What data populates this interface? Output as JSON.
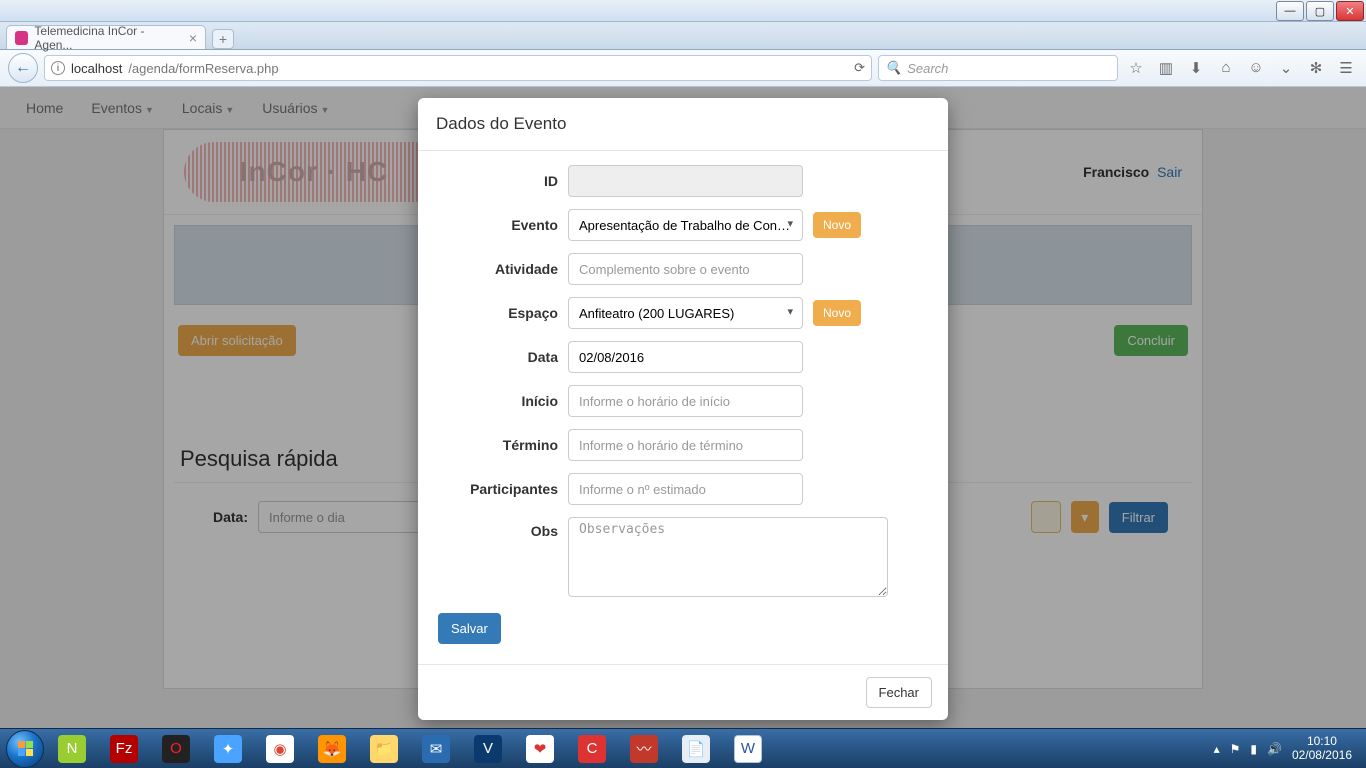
{
  "window": {
    "tab_title": "Telemedicina InCor - Agen...",
    "url_host": "localhost",
    "url_path": "/agenda/formReserva.php",
    "search_placeholder": "Search"
  },
  "nav": {
    "home": "Home",
    "eventos": "Eventos",
    "locais": "Locais",
    "usuarios": "Usuários"
  },
  "user": {
    "name": "Francisco",
    "logout": "Sair"
  },
  "actions": {
    "abrir": "Abrir solicitação",
    "concluir": "Concluir"
  },
  "quicksearch": {
    "title": "Pesquisa rápida",
    "data_label": "Data:",
    "data_placeholder": "Informe o dia",
    "filtrar": "Filtrar"
  },
  "modal": {
    "title": "Dados do Evento",
    "labels": {
      "id": "ID",
      "evento": "Evento",
      "atividade": "Atividade",
      "espaco": "Espaço",
      "data": "Data",
      "inicio": "Início",
      "termino": "Término",
      "participantes": "Participantes",
      "obs": "Obs"
    },
    "values": {
      "evento": "Apresentação de Trabalho de Conclusão",
      "espaco": "Anfiteatro (200 LUGARES)",
      "data": "02/08/2016"
    },
    "placeholders": {
      "atividade": "Complemento sobre o evento",
      "inicio": "Informe o horário de início",
      "termino": "Informe o horário de término",
      "participantes": "Informe o nº estimado",
      "obs": "Observações"
    },
    "novo": "Novo",
    "salvar": "Salvar",
    "fechar": "Fechar"
  },
  "taskbar": {
    "time": "10:10",
    "date": "02/08/2016"
  }
}
